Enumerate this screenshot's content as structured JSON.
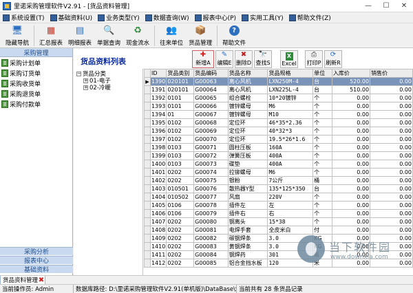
{
  "window": {
    "title": "里诺采购管理软件V2.91 - [货品资料管理]",
    "minimize": "—",
    "maximize": "☐",
    "close": "✕"
  },
  "menu": [
    {
      "label": "系统设置(T)",
      "icon": "settings-icon"
    },
    {
      "label": "基础资料(U)",
      "icon": "data-icon"
    },
    {
      "label": "业务类型(Y)",
      "icon": "business-icon"
    },
    {
      "label": "数据查询(W)",
      "icon": "query-icon"
    },
    {
      "label": "报表中心(P)",
      "icon": "report-icon"
    },
    {
      "label": "实用工具(Y)",
      "icon": "tools-icon"
    },
    {
      "label": "帮助文件(Z)",
      "icon": "help-icon"
    }
  ],
  "toolbar": [
    {
      "label": "隐藏导航",
      "icon": "monitor-icon",
      "glyph": "🖥"
    },
    {
      "label": "汇总报表",
      "icon": "summary-report-icon",
      "glyph": "▦"
    },
    {
      "label": "明细报表",
      "icon": "detail-report-icon",
      "glyph": "▤"
    },
    {
      "label": "单据查询",
      "icon": "doc-search-icon",
      "glyph": "🔍"
    },
    {
      "label": "现金流水",
      "icon": "cash-flow-icon",
      "glyph": "♻"
    },
    {
      "label": "往来单位",
      "icon": "contacts-icon",
      "glyph": "👥"
    },
    {
      "label": "货品管理",
      "icon": "goods-icon",
      "glyph": "📦"
    },
    {
      "label": "帮助文件",
      "icon": "help-icon",
      "glyph": "?"
    }
  ],
  "nav": {
    "header": "采购管理",
    "items": [
      "采购计划单",
      "采购订货单",
      "采购收货单",
      "采购退货单",
      "采购付款单"
    ],
    "bottom": [
      "采购分析",
      "报表中心",
      "基础资料"
    ]
  },
  "content": {
    "title": "货品资料列表",
    "buttons": [
      {
        "label": "新增A",
        "glyph": "✚"
      },
      {
        "label": "编辑E",
        "glyph": "✎"
      },
      {
        "label": "删除D",
        "glyph": "✖"
      },
      {
        "label": "查找S",
        "glyph": "🔭"
      },
      {
        "label": "Excel",
        "glyph": "X"
      },
      {
        "label": "打印P",
        "glyph": "⎙"
      },
      {
        "label": "刷新R",
        "glyph": "⟳"
      }
    ]
  },
  "tree": {
    "root": "货品分类",
    "children": [
      "01-电子",
      "02-冷暖"
    ]
  },
  "table": {
    "columns": [
      "ID",
      "货品类别",
      "货品编码",
      "货品名称",
      "货品规格",
      "单位",
      "入库价",
      "销售价"
    ],
    "rows": [
      [
        "1390",
        "020101",
        "G00063",
        "离心风机",
        "LXN250M-4",
        "台",
        "520.00",
        "0.00"
      ],
      [
        "1391",
        "020101",
        "G00064",
        "离心风机",
        "LXN225L-4",
        "台",
        "510.00",
        "0.00"
      ],
      [
        "1392",
        "0101",
        "G00065",
        "组合螺栓",
        "10*20镀锌",
        "个",
        "0.00",
        "0.00"
      ],
      [
        "1393",
        "0101",
        "G00066",
        "镀锌螺母",
        "M6",
        "个",
        "0.00",
        "0.00"
      ],
      [
        "1394",
        "01",
        "G00067",
        "镀锌螺母",
        "M10",
        "个",
        "0.00",
        "0.00"
      ],
      [
        "1395",
        "0102",
        "G00068",
        "定位环",
        "46*35*2.36",
        "个",
        "0.00",
        "0.00"
      ],
      [
        "1396",
        "0102",
        "G00069",
        "定位环",
        "40*32*3",
        "个",
        "0.00",
        "0.00"
      ],
      [
        "1397",
        "0102",
        "G00070",
        "定位环",
        "19.5*26*1.6",
        "个",
        "0.00",
        "0.00"
      ],
      [
        "1398",
        "0103",
        "G00071",
        "圆柱压板",
        "160A",
        "个",
        "0.00",
        "0.00"
      ],
      [
        "1399",
        "0103",
        "G00072",
        "弹簧压板",
        "400A",
        "个",
        "0.00",
        "0.00"
      ],
      [
        "1400",
        "0103",
        "G00073",
        "碟垫",
        "400A",
        "个",
        "0.00",
        "0.00"
      ],
      [
        "1401",
        "0202",
        "G00074",
        "拉铆螺母",
        "M6",
        "个",
        "0.00",
        "0.00"
      ],
      [
        "1402",
        "0202",
        "G00075",
        "银粉",
        "7公斤",
        "桶",
        "0.00",
        "0.00"
      ],
      [
        "1403",
        "010501",
        "G00076",
        "散热器Y型",
        "135*125*350",
        "台",
        "0.00",
        "0.00"
      ],
      [
        "1404",
        "010502",
        "G00077",
        "风扇",
        "220V",
        "个",
        "0.00",
        "0.00"
      ],
      [
        "1405",
        "0106",
        "G00078",
        "插件左",
        "左",
        "个",
        "0.00",
        "0.00"
      ],
      [
        "1406",
        "0106",
        "G00079",
        "插件右",
        "右",
        "个",
        "0.00",
        "0.00"
      ],
      [
        "1407",
        "0202",
        "G00080",
        "钢离头",
        "15*38",
        "个",
        "0.00",
        "0.00"
      ],
      [
        "1408",
        "0202",
        "G00081",
        "电焊手套",
        "全皮米白",
        "付",
        "0.00",
        "0.00"
      ],
      [
        "1409",
        "0202",
        "G00082",
        "碳钢焊条",
        "3.0",
        "KG",
        "0.00",
        "0.00"
      ],
      [
        "1410",
        "0202",
        "G00083",
        "黄钢焊条",
        "3.0",
        "KG",
        "0.00",
        "0.00"
      ],
      [
        "1411",
        "0202",
        "G00084",
        "钢焊药",
        "301",
        "瓶",
        "0.00",
        "0.00"
      ],
      [
        "1412",
        "0202",
        "G00085",
        "铝合金挡水板",
        "120",
        "米",
        "0.00",
        "0.00"
      ]
    ],
    "selected_row": 0,
    "row_indicator": "▶"
  },
  "tabs": [
    {
      "label": "货品资料管理",
      "close": "✖"
    }
  ],
  "status": {
    "operator": "当前操作员: Admin",
    "db_path": "数据库路径: D:\\里诺采购管理软件V2.91(单机版)\\DataBase\\Stoc",
    "count": "当前共有 28 条货品记录"
  },
  "watermark": {
    "cn": "当下软件园",
    "en": "www.downxia.com"
  }
}
